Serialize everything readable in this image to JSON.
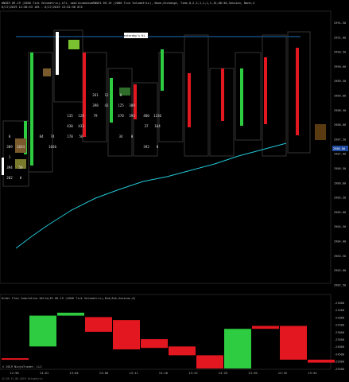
{
  "header": {
    "line1": "ONGE5 09-19 (2000 Tick Volumetric),LF1, smallo=mediumRNGE5 09-19 (2000 Tick Volumetric), None,Exchange, Time,0,2,2,1,1,1,1,15,08:30,Session, None,4",
    "line2": "6/17/2019 12:58:53 165 - 6/17/2019 13:52:56 874"
  },
  "price_scale": [
    "2991.50",
    "2991.00",
    "2990.50",
    "2990.00",
    "2989.50",
    "2989.00",
    "2988.50",
    "2988.00",
    "2987.50",
    "2987.00",
    "2986.50",
    "2986.00",
    "2985.50",
    "2985.00",
    "2984.50",
    "2984.00",
    "2983.50",
    "2983.00",
    "2982.50"
  ],
  "current_price": "2988.00",
  "annotation": "Yesterday's Hi...",
  "lower_panel": {
    "title": "Order Flow Cumulative Delta(ES 06-19 (2000 Tick Volumetric),Bid/Ask,Session,0)",
    "scale": [
      "-21000",
      "-21500",
      "-22000",
      "-22500",
      "-23000",
      "-23500",
      "-24000",
      "-24500",
      "-25000",
      "-25500"
    ]
  },
  "time_axis": [
    "12:58",
    "13:01",
    "13:04",
    "13:08",
    "13:11",
    "13:16",
    "13:22",
    "13:25",
    "13:30",
    "13:32",
    "13:52"
  ],
  "copyright": "© 2019 NinjaTrader, LLC",
  "status_bar": "12:58 17-06-2019 Volumetric",
  "colors": {
    "up": "#2ecc40",
    "down": "#e3171f",
    "ma": "#22c8d8",
    "level": "#1f6fb8"
  },
  "chart_data": {
    "type": "volumetric-footprint",
    "bars": [
      {
        "cells": [
          [
            "",
            ""
          ],
          [
            "",
            ""
          ],
          [
            "",
            ""
          ],
          [
            "",
            ""
          ],
          [
            "",
            ""
          ],
          [
            "",
            ""
          ],
          [
            "",
            ""
          ],
          [
            "",
            ""
          ],
          [
            "",
            ""
          ],
          [
            "",
            ""
          ],
          [
            "",
            ""
          ],
          [
            "0",
            ""
          ],
          [
            "389",
            "1034"
          ],
          [
            "1",
            ""
          ],
          [
            "394",
            "50"
          ],
          [
            "202",
            "0"
          ]
        ]
      },
      {
        "cells": [
          [
            "",
            ""
          ],
          [
            "",
            ""
          ],
          [
            "",
            ""
          ],
          [
            "",
            ""
          ],
          [
            "",
            ""
          ],
          [
            "",
            ""
          ],
          [
            "",
            ""
          ],
          [
            "",
            ""
          ],
          [
            "",
            ""
          ],
          [
            "",
            ""
          ],
          [
            "",
            ""
          ],
          [
            "84",
            "74"
          ],
          [
            "",
            "1036"
          ],
          [
            "",
            ""
          ],
          [
            "",
            ""
          ],
          [
            "",
            ""
          ]
        ]
      },
      {
        "cells": [
          [
            "",
            ""
          ],
          [
            "",
            ""
          ],
          [
            "",
            ""
          ],
          [
            "",
            ""
          ],
          [
            "",
            ""
          ],
          [
            "",
            ""
          ],
          [
            "",
            ""
          ],
          [
            "",
            ""
          ],
          [
            "",
            ""
          ],
          [
            "135",
            "128"
          ],
          [
            "430",
            "433"
          ],
          [
            "170",
            "56"
          ],
          [
            "",
            ""
          ],
          [
            "",
            ""
          ],
          [
            "",
            ""
          ],
          [
            "",
            ""
          ]
        ]
      },
      {
        "cells": [
          [
            "",
            ""
          ],
          [
            "",
            ""
          ],
          [
            "",
            ""
          ],
          [
            "",
            ""
          ],
          [
            "",
            ""
          ],
          [
            "",
            ""
          ],
          [
            "",
            ""
          ],
          [
            "261",
            "12"
          ],
          [
            "398",
            "43"
          ],
          [
            "79",
            ""
          ],
          [
            "",
            ""
          ],
          [
            "",
            ""
          ],
          [
            "",
            ""
          ],
          [
            "",
            ""
          ],
          [
            "",
            ""
          ],
          [
            "",
            ""
          ]
        ]
      },
      {
        "cells": [
          [
            "",
            ""
          ],
          [
            "",
            ""
          ],
          [
            "",
            ""
          ],
          [
            "",
            ""
          ],
          [
            "",
            ""
          ],
          [
            "",
            ""
          ],
          [
            "",
            ""
          ],
          [
            "0",
            ""
          ],
          [
            "125",
            "309"
          ],
          [
            "470",
            "393"
          ],
          [
            "",
            ""
          ],
          [
            "34",
            "0"
          ],
          [
            "",
            ""
          ],
          [
            "",
            ""
          ],
          [
            "",
            ""
          ],
          [
            "",
            ""
          ]
        ]
      },
      {
        "cells": [
          [
            "",
            ""
          ],
          [
            "",
            ""
          ],
          [
            "",
            ""
          ],
          [
            "",
            ""
          ],
          [
            "",
            ""
          ],
          [
            "",
            ""
          ],
          [
            "",
            ""
          ],
          [
            "",
            ""
          ],
          [
            "",
            ""
          ],
          [
            "480",
            "1236"
          ],
          [
            "37",
            "164"
          ],
          [
            "",
            ""
          ],
          [
            "392",
            "0"
          ],
          [
            "",
            ""
          ],
          [
            "",
            ""
          ],
          [
            "",
            ""
          ]
        ]
      }
    ],
    "cumulative_delta_candles": [
      {
        "open": -24800,
        "close": -24800,
        "dir": "down"
      },
      {
        "open": -24000,
        "close": -21900,
        "dir": "up"
      },
      {
        "open": -21900,
        "close": -21700,
        "dir": "up"
      },
      {
        "open": -22000,
        "close": -23000,
        "dir": "down"
      },
      {
        "open": -22200,
        "close": -24200,
        "dir": "down"
      },
      {
        "open": -23500,
        "close": -24100,
        "dir": "down"
      },
      {
        "open": -24000,
        "close": -24600,
        "dir": "down"
      },
      {
        "open": -24600,
        "close": -25500,
        "dir": "down"
      },
      {
        "open": -25500,
        "close": -22800,
        "dir": "up"
      },
      {
        "open": -22600,
        "close": -22800,
        "dir": "down"
      },
      {
        "open": -22600,
        "close": -24900,
        "dir": "down"
      },
      {
        "open": -24900,
        "close": -25100,
        "dir": "down"
      }
    ]
  }
}
